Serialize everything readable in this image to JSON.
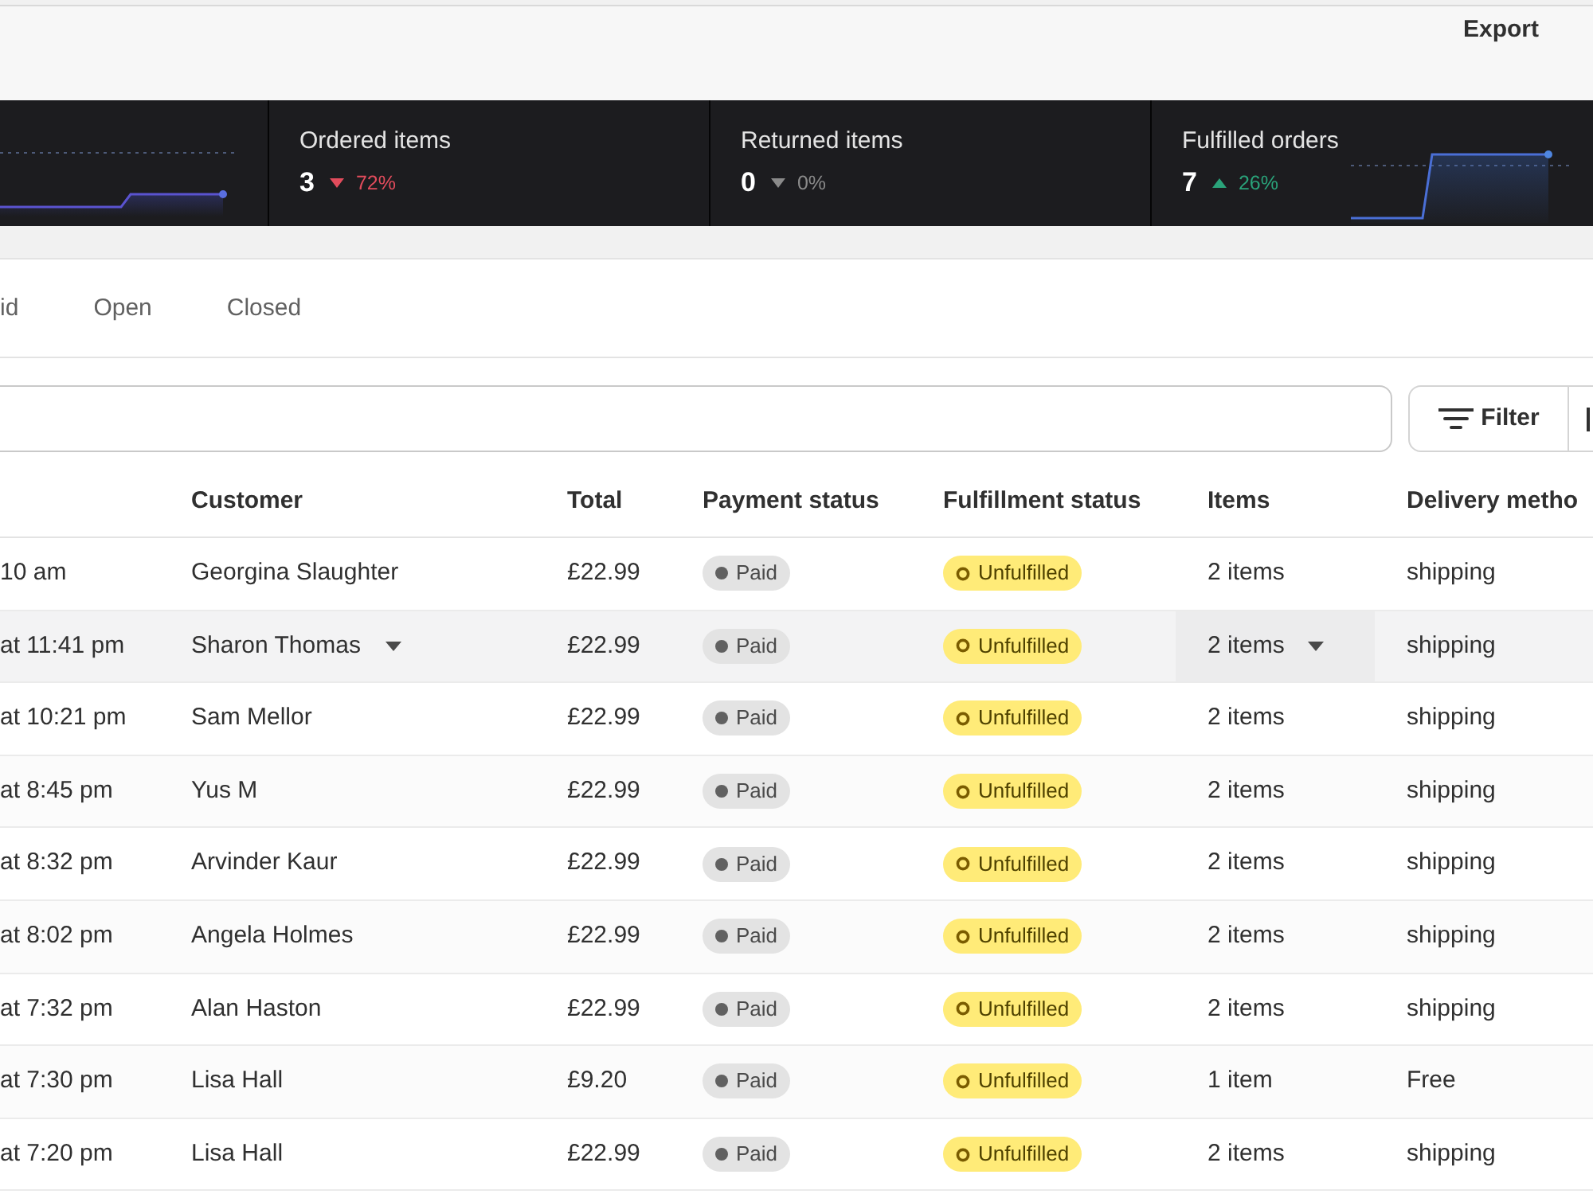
{
  "toolbar": {
    "export": "Export"
  },
  "metrics": [
    {
      "kind": "partial",
      "sparkline": true
    },
    {
      "kind": "down",
      "title": "Ordered items",
      "value": "3",
      "change": "72%",
      "sparkline": false
    },
    {
      "kind": "flat",
      "title": "Returned items",
      "value": "0",
      "change": "0%",
      "sparkline": false
    },
    {
      "kind": "up",
      "title": "Fulfilled orders",
      "value": "7",
      "change": "26%",
      "sparkline": true
    }
  ],
  "tabs": [
    {
      "label": "id",
      "selected": false
    },
    {
      "label": "Open",
      "selected": false
    },
    {
      "label": "Closed",
      "selected": false
    }
  ],
  "filter_button": {
    "label": "Filter"
  },
  "table": {
    "columns": [
      "Customer",
      "Total",
      "Payment status",
      "Fulfillment status",
      "Items",
      "Delivery metho"
    ],
    "rows": [
      {
        "date": "10 am",
        "customer": "Georgina Slaughter",
        "total": "£22.99",
        "payment_status": "Paid",
        "fulfillment_status": "Unfulfilled",
        "items": "2 items",
        "delivery_method": "shipping",
        "highlighted": false
      },
      {
        "date": "at 11:41 pm",
        "customer": "Sharon Thomas",
        "total": "£22.99",
        "payment_status": "Paid",
        "fulfillment_status": "Unfulfilled",
        "items": "2 items",
        "delivery_method": "shipping",
        "highlighted": true
      },
      {
        "date": "at 10:21 pm",
        "customer": "Sam Mellor",
        "total": "£22.99",
        "payment_status": "Paid",
        "fulfillment_status": "Unfulfilled",
        "items": "2 items",
        "delivery_method": "shipping",
        "highlighted": false
      },
      {
        "date": "at 8:45 pm",
        "customer": "Yus M",
        "total": "£22.99",
        "payment_status": "Paid",
        "fulfillment_status": "Unfulfilled",
        "items": "2 items",
        "delivery_method": "shipping",
        "highlighted": false
      },
      {
        "date": "at 8:32 pm",
        "customer": "Arvinder Kaur",
        "total": "£22.99",
        "payment_status": "Paid",
        "fulfillment_status": "Unfulfilled",
        "items": "2 items",
        "delivery_method": "shipping",
        "highlighted": false
      },
      {
        "date": "at 8:02 pm",
        "customer": "Angela Holmes",
        "total": "£22.99",
        "payment_status": "Paid",
        "fulfillment_status": "Unfulfilled",
        "items": "2 items",
        "delivery_method": "shipping",
        "highlighted": false
      },
      {
        "date": "at 7:32 pm",
        "customer": "Alan Haston",
        "total": "£22.99",
        "payment_status": "Paid",
        "fulfillment_status": "Unfulfilled",
        "items": "2 items",
        "delivery_method": "shipping",
        "highlighted": false
      },
      {
        "date": "at 7:30 pm",
        "customer": "Lisa Hall",
        "total": "£9.20",
        "payment_status": "Paid",
        "fulfillment_status": "Unfulfilled",
        "items": "1 item",
        "delivery_method": "Free",
        "highlighted": false
      },
      {
        "date": "at 7:20 pm",
        "customer": "Lisa Hall",
        "total": "£22.99",
        "payment_status": "Paid",
        "fulfillment_status": "Unfulfilled",
        "items": "2 items",
        "delivery_method": "shipping",
        "highlighted": false
      }
    ]
  }
}
